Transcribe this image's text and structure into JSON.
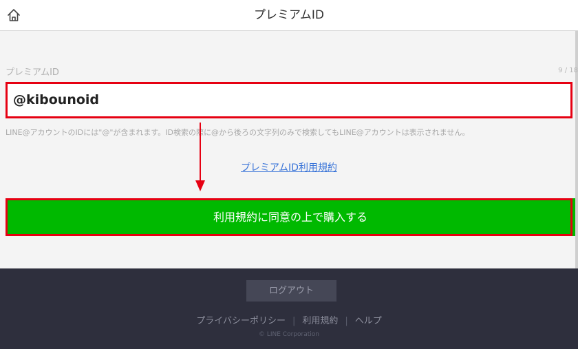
{
  "header": {
    "title": "プレミアムID"
  },
  "form": {
    "field_label": "プレミアムID",
    "counter": "9 / 18",
    "id_value": "@kibounoid",
    "note": "LINE@アカウントのIDには\"@\"が含まれます。ID検索の際に@から後ろの文字列のみで検索してもLINE@アカウントは表示されません。",
    "terms_link": "プレミアムID利用規約",
    "submit_label": "利用規約に同意の上で購入する"
  },
  "footer": {
    "logout_label": "ログアウト",
    "privacy_label": "プライバシーポリシー",
    "terms_label": "利用規約",
    "help_label": "ヘルプ",
    "separator": "|",
    "copyright": "© LINE Corporation"
  },
  "colors": {
    "accent_green": "#00b900",
    "highlight_red": "#e60012",
    "link_blue": "#3873d8",
    "footer_bg": "#2e2f3d"
  },
  "icons": {
    "home": "home-icon",
    "arrow": "down-arrow-annotation"
  }
}
